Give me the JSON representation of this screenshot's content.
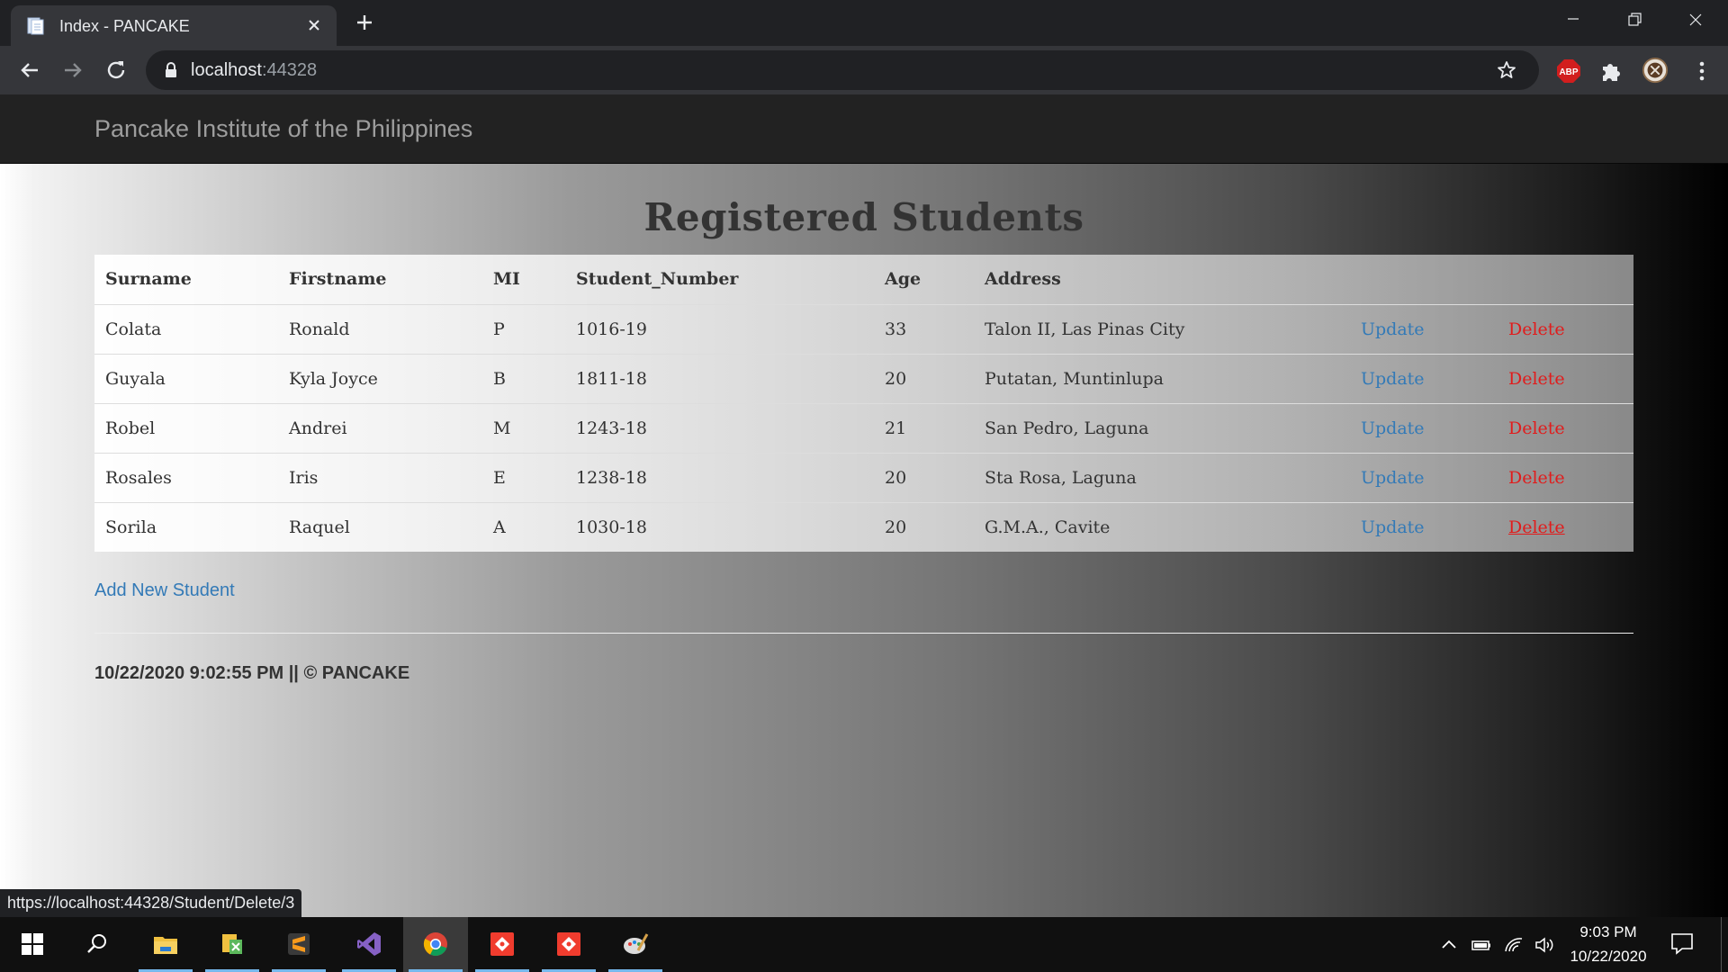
{
  "browser": {
    "tab_title": "Index - PANCAKE",
    "url_host": "localhost",
    "url_port": ":44328",
    "status_url": "https://localhost:44328/Student/Delete/3",
    "extensions": [
      "adblock-plus-icon",
      "extensions-puzzle-icon",
      "profile-avatar",
      "menu-kebab-icon"
    ],
    "abp_label": "ABP"
  },
  "site": {
    "brand": "Pancake Institute of the Philippines",
    "heading": "Registered Students",
    "columns": [
      "Surname",
      "Firstname",
      "MI",
      "Student_Number",
      "Age",
      "Address"
    ],
    "update_label": "Update",
    "delete_label": "Delete",
    "students": [
      {
        "surname": "Colata",
        "firstname": "Ronald",
        "mi": "P",
        "student_number": "1016-19",
        "age": "33",
        "address": "Talon II, Las Pinas City"
      },
      {
        "surname": "Guyala",
        "firstname": "Kyla Joyce",
        "mi": "B",
        "student_number": "1811-18",
        "age": "20",
        "address": "Putatan, Muntinlupa"
      },
      {
        "surname": "Robel",
        "firstname": "Andrei",
        "mi": "M",
        "student_number": "1243-18",
        "age": "21",
        "address": "San Pedro, Laguna"
      },
      {
        "surname": "Rosales",
        "firstname": "Iris",
        "mi": "E",
        "student_number": "1238-18",
        "age": "20",
        "address": "Sta Rosa, Laguna"
      },
      {
        "surname": "Sorila",
        "firstname": "Raquel",
        "mi": "A",
        "student_number": "1030-18",
        "age": "20",
        "address": "G.M.A., Cavite"
      }
    ],
    "add_link": "Add New Student",
    "footer": "10/22/2020 9:02:55 PM || © PANCAKE"
  },
  "colors": {
    "link_blue": "#337ab7",
    "delete_red": "#e11c1c",
    "navbar": "#222222"
  },
  "taskbar": {
    "apps": [
      "windows-start-icon",
      "search-icon",
      "file-explorer-icon",
      "sticky-app-icon",
      "sublime-text-icon",
      "visual-studio-icon",
      "chrome-icon",
      "git-app-icon",
      "git-app-icon-2",
      "paint-icon"
    ],
    "time": "9:03 PM",
    "date": "10/22/2020"
  }
}
